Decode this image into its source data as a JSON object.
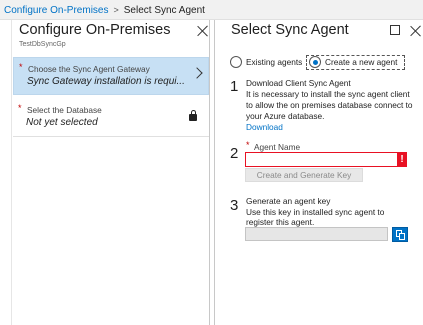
{
  "breadcrumb": {
    "parent": "Configure On-Premises",
    "separator": ">",
    "current": "Select Sync Agent"
  },
  "left_blade": {
    "title": "Configure On-Premises",
    "subtitle": "TestDbSyncGp",
    "steps": [
      {
        "label": "Choose the Sync Agent Gateway",
        "value": "Sync Gateway installation is requi...",
        "required": true,
        "state": "active",
        "indicator": "chevron-right-icon"
      },
      {
        "label": "Select the Database",
        "value": "Not yet selected",
        "required": true,
        "state": "locked",
        "indicator": "lock-icon"
      }
    ]
  },
  "right_blade": {
    "title": "Select Sync Agent",
    "options": [
      {
        "label": "Existing agents",
        "checked": false
      },
      {
        "label": "Create a new agent",
        "checked": true
      }
    ],
    "step1": {
      "number": "1",
      "heading": "Download Client Sync Agent",
      "line1": "It is necessary to install the sync agent client",
      "line2": "to allow the on premises database connect to",
      "line3": "your Azure database.",
      "link": "Download"
    },
    "step2": {
      "number": "2",
      "field_label": "Agent Name",
      "field_value": "",
      "error_mark": "!",
      "button_label": "Create and Generate Key"
    },
    "step3": {
      "number": "3",
      "heading": "Generate an agent key",
      "line1": "Use this key in installed sync agent to",
      "line2": "register this agent."
    }
  },
  "colors": {
    "accent": "#0072c6",
    "active_step_bg": "#c7e0f4",
    "error": "#e81123",
    "required": "#c00000"
  }
}
